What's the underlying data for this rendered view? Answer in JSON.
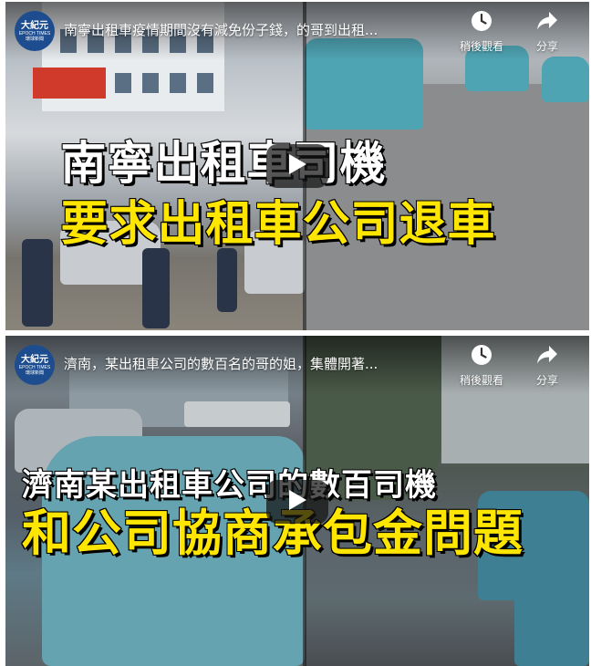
{
  "videos": [
    {
      "channel": {
        "logo_cn": "大紀元",
        "logo_en": "EPOCH TIMES",
        "logo_sub": "環球新聞"
      },
      "title": "南寧出租車疫情期間沒有減免份子錢，的哥到出租...",
      "headline_line1": "南寧出租車司機",
      "headline_line2": "要求出租車公司退車",
      "watch_later_label": "稍後觀看",
      "share_label": "分享"
    },
    {
      "channel": {
        "logo_cn": "大紀元",
        "logo_en": "EPOCH TIMES",
        "logo_sub": "環球新聞"
      },
      "title": "濟南，某出租車公司的數百名的哥的姐，集體開著...",
      "headline_line1": "濟南某出租車公司的數百司機",
      "headline_line2": "和公司協商承包金問題",
      "watch_later_label": "稍後觀看",
      "share_label": "分享"
    }
  ],
  "colors": {
    "headline_yellow": "#ffe600",
    "headline_white": "#ffffff",
    "logo_blue": "#1d4d8f"
  },
  "icons": {
    "watch_later": "clock-icon",
    "share": "share-arrow-icon",
    "play": "play-icon"
  }
}
